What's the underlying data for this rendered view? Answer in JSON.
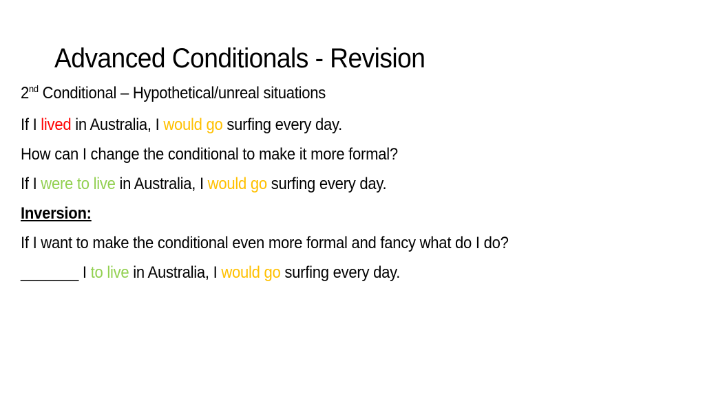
{
  "slide": {
    "title": "Advanced Conditionals - Revision",
    "lines": {
      "l1": {
        "num": "2",
        "sup": "nd",
        "rest": " Conditional – Hypothetical/unreal situations"
      },
      "l2": {
        "a": "If I ",
        "b": "lived",
        "c": " in Australia, I ",
        "d": "would go",
        "e": " surfing every day."
      },
      "l3": {
        "text": "How can I change the conditional to make it more formal?"
      },
      "l4": {
        "a": "If I ",
        "b": "were to live",
        "c": " in Australia, I ",
        "d": "would go",
        "e": " surfing every day."
      },
      "l5": {
        "text": "Inversion:"
      },
      "l6": {
        "text": "If I want to make the conditional even more formal and fancy what do I do?"
      },
      "l7": {
        "blank": "_______",
        "a": " I ",
        "b": "to live",
        "c": " in Australia, I ",
        "d": "would go",
        "e": " surfing every day."
      }
    },
    "colors": {
      "past": "#FF0000",
      "would": "#FFC000",
      "formal": "#92D050"
    }
  }
}
